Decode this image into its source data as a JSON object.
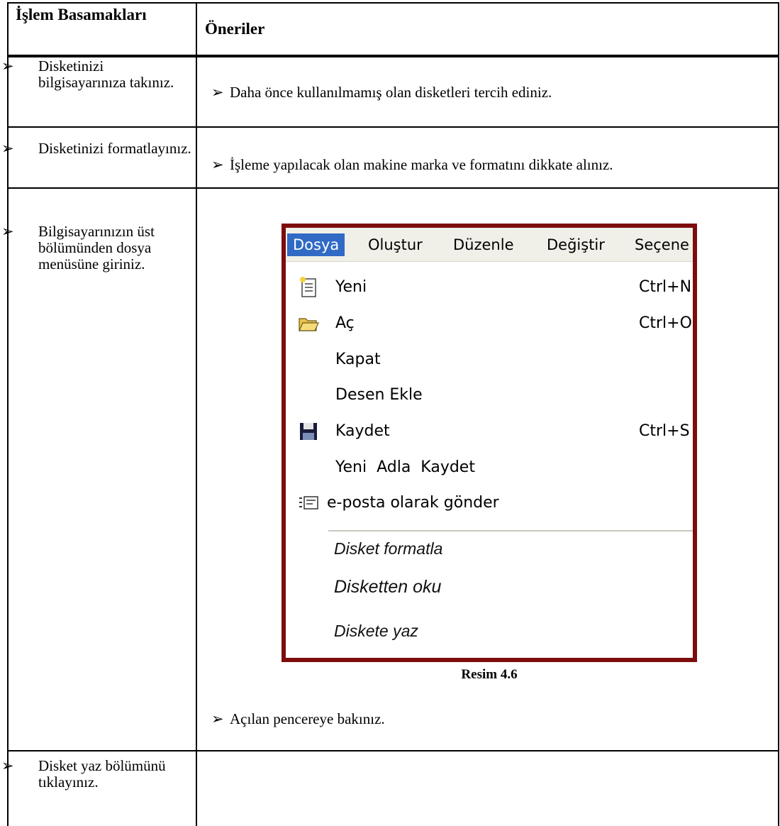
{
  "table": {
    "headers": {
      "col1": "İşlem Basamakları",
      "col2": "Öneriler"
    },
    "rows": [
      {
        "step": "Disketinizi bilgisayarınıza takınız.",
        "suggestion": "Daha önce kullanılmamış olan disketleri tercih ediniz."
      },
      {
        "step": "Disketinizi formatlayınız.",
        "suggestion": "İşleme yapılacak olan makine marka ve formatını dikkate alınız."
      },
      {
        "step": "Bilgisayarınızın üst bölümünden dosya menüsüne giriniz.",
        "suggestion": "Açılan pencereye bakınız."
      },
      {
        "step": "Disket yaz bölümünü tıklayınız.",
        "suggestion": ""
      }
    ],
    "bullet_glyph": "➢"
  },
  "figure": {
    "caption": "Resim 4.6",
    "menubar": [
      "Dosya",
      "Oluştur",
      "Düzenle",
      "Değiştir",
      "Seçene"
    ],
    "menu_items": [
      {
        "label": "Yeni",
        "shortcut": "Ctrl+N",
        "icon": "new-document-icon"
      },
      {
        "label": "Aç",
        "shortcut": "Ctrl+O",
        "icon": "open-folder-icon"
      },
      {
        "label": "Kapat",
        "shortcut": "",
        "icon": ""
      },
      {
        "label": "Desen Ekle",
        "shortcut": "",
        "icon": ""
      },
      {
        "label": "Kaydet",
        "shortcut": "Ctrl+S",
        "icon": "save-disk-icon"
      },
      {
        "label": "Yeni  Adla  Kaydet",
        "shortcut": "",
        "icon": ""
      },
      {
        "label": "e-posta olarak gönder",
        "shortcut": "",
        "icon": "email-icon"
      }
    ],
    "disk_items": [
      "Disket formatla",
      "Disketten oku",
      "Diskete yaz"
    ],
    "colors": {
      "frame": "#7d0d0d",
      "menu_highlight": "#316ac5",
      "menubar_bg": "#f0efe8"
    }
  }
}
